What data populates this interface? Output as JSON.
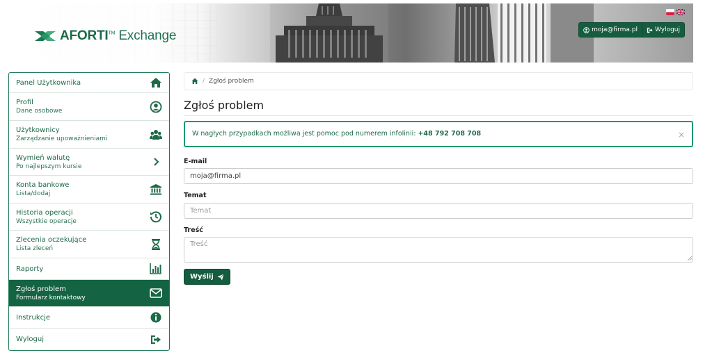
{
  "header": {
    "brand_name": "AFORTI",
    "brand_suffix": "Exchange",
    "brand_tm": "TM",
    "user_email": "moja@firma.pl",
    "logout_label": "Wyloguj"
  },
  "sidebar": {
    "items": [
      {
        "title": "Panel Użytkownika",
        "sub": "",
        "icon": "home-icon"
      },
      {
        "title": "Profil",
        "sub": "Dane osobowe",
        "icon": "user-circle-icon"
      },
      {
        "title": "Użytkownicy",
        "sub": "Zarządzanie upoważnieniami",
        "icon": "users-icon"
      },
      {
        "title": "Wymień walutę",
        "sub": "Po najlepszym kursie",
        "icon": "chevron-right-icon"
      },
      {
        "title": "Konta bankowe",
        "sub": "Lista/dodaj",
        "icon": "bank-icon"
      },
      {
        "title": "Historia operacji",
        "sub": "Wszystkie operacje",
        "icon": "history-icon"
      },
      {
        "title": "Zlecenia oczekujące",
        "sub": "Lista zleceń",
        "icon": "hourglass-icon"
      },
      {
        "title": "Raporty",
        "sub": "",
        "icon": "bar-chart-icon"
      },
      {
        "title": "Zgłoś problem",
        "sub": "Formularz kontaktowy",
        "icon": "envelope-icon",
        "active": true
      },
      {
        "title": "Instrukcje",
        "sub": "",
        "icon": "info-icon"
      },
      {
        "title": "Wyloguj",
        "sub": "",
        "icon": "sign-out-icon"
      }
    ]
  },
  "breadcrumb": {
    "current": "Zgłoś problem"
  },
  "main": {
    "title": "Zgłoś problem",
    "alert_text": "W nagłych przypadkach możliwa jest pomoc pod numerem infolinii: ",
    "alert_phone": "+48 792 708 708",
    "alert_close": "×",
    "form": {
      "email_label": "E-mail",
      "email_value": "moja@firma.pl",
      "subject_label": "Temat",
      "subject_placeholder": "Temat",
      "body_label": "Treść",
      "body_placeholder": "Treść",
      "submit_label": "Wyślij"
    }
  },
  "colors": {
    "brand_green": "#146444",
    "alert_border": "#1d9a6a"
  }
}
